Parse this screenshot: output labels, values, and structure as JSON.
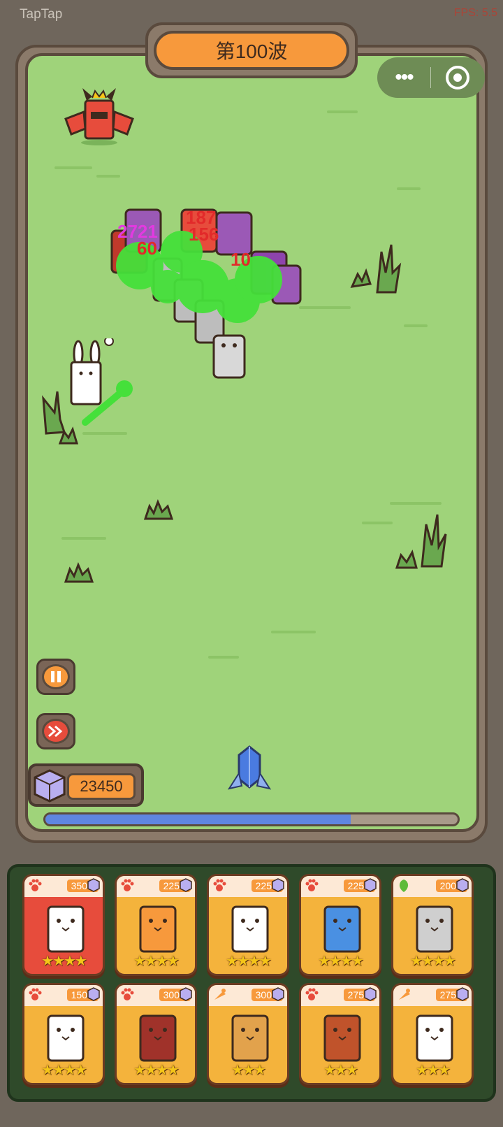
{
  "header": {
    "app_name": "TapTap",
    "fps": "FPS: 5.5"
  },
  "wave": {
    "label": "第100波"
  },
  "capsule": {
    "more": "•••",
    "close_icon": "record-circle-icon"
  },
  "damage_numbers": [
    "187",
    "156",
    "2721",
    "10",
    "60"
  ],
  "controls": {
    "pause_icon": "pause-icon",
    "speed_icon": "fast-forward-icon"
  },
  "resources": {
    "gems": "23450"
  },
  "wave_progress": 0.74,
  "cards": [
    {
      "name": "white-tiger",
      "cost": "350",
      "type": "paw",
      "stars": "★★★★",
      "bg": "red"
    },
    {
      "name": "tiger",
      "cost": "225",
      "type": "paw",
      "stars": "★★★★",
      "bg": "orange"
    },
    {
      "name": "panda",
      "cost": "225",
      "type": "paw",
      "stars": "★★★★",
      "bg": "orange"
    },
    {
      "name": "shark",
      "cost": "225",
      "type": "paw",
      "stars": "★★★★",
      "bg": "orange"
    },
    {
      "name": "snow-leopard",
      "cost": "200",
      "type": "leaf",
      "stars": "★★★★",
      "bg": "orange"
    },
    {
      "name": "frog",
      "cost": "150",
      "type": "paw",
      "stars": "★★★★",
      "bg": "orange"
    },
    {
      "name": "horse",
      "cost": "300",
      "type": "paw",
      "stars": "★★★★",
      "bg": "orange"
    },
    {
      "name": "beaver",
      "cost": "300",
      "type": "carrot",
      "stars": "★★★",
      "bg": "orange"
    },
    {
      "name": "red-panda",
      "cost": "275",
      "type": "paw",
      "stars": "★★★",
      "bg": "orange"
    },
    {
      "name": "rabbit",
      "cost": "275",
      "type": "carrot",
      "stars": "★★★",
      "bg": "orange"
    }
  ],
  "colors": {
    "field": "#9fd37a",
    "frame": "#5a4a3d",
    "accent": "#f7993c",
    "progress": "#5f86e0",
    "card_red": "#e74c3c",
    "card_orange": "#f4b33c"
  }
}
